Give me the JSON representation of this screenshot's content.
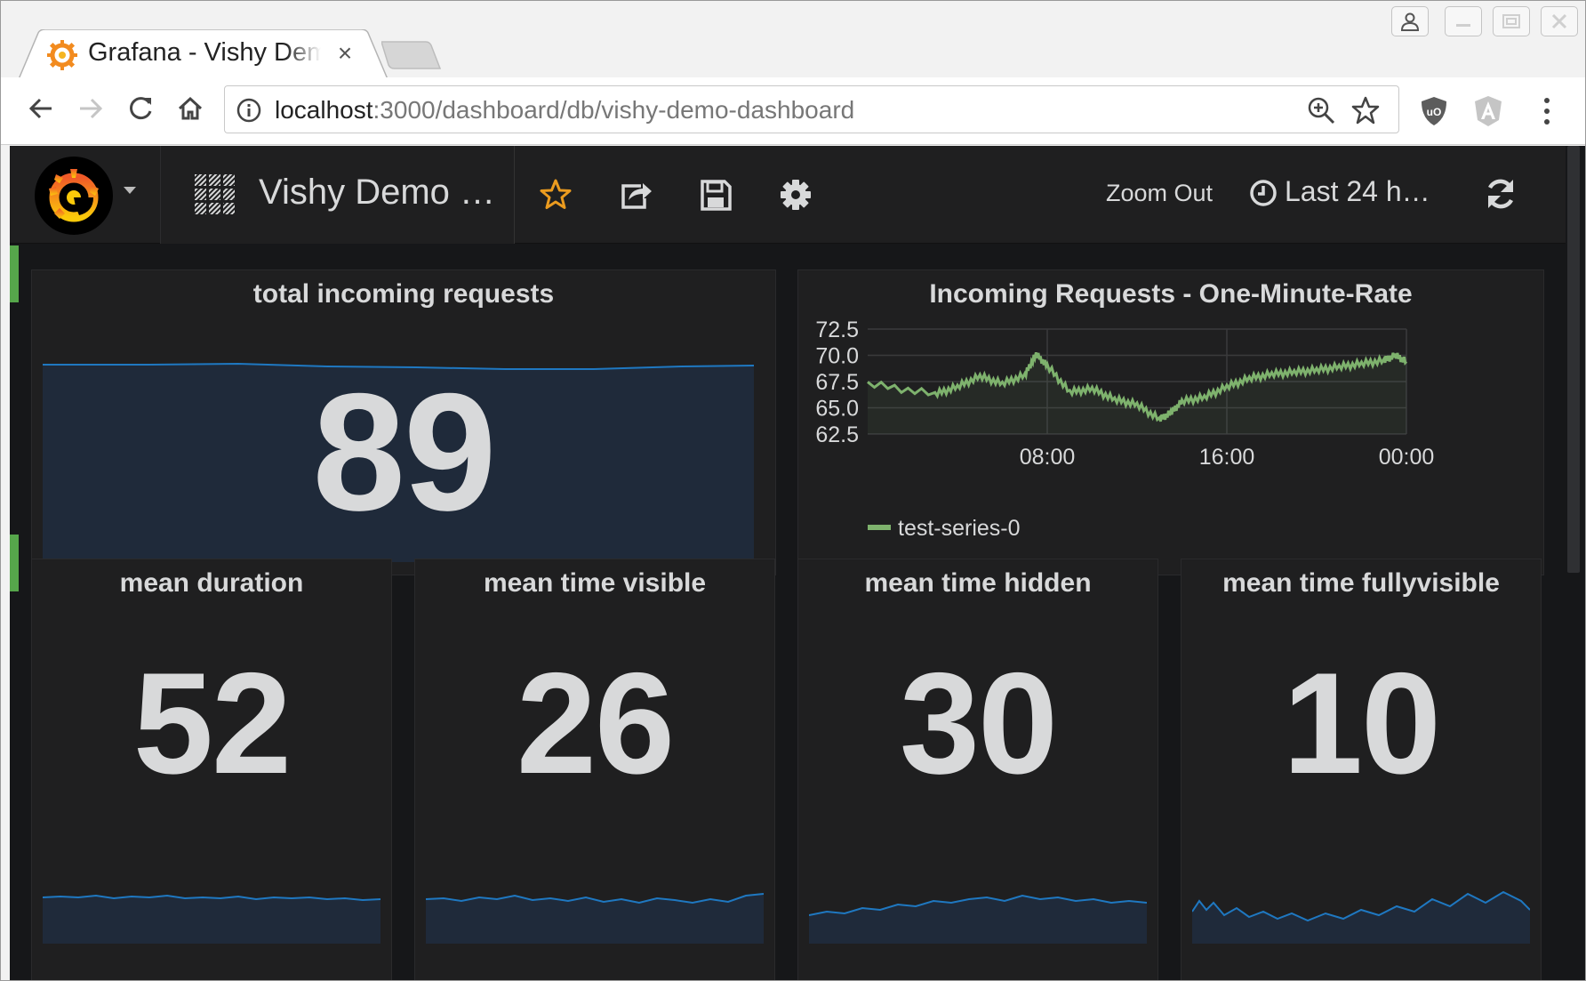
{
  "browser": {
    "tab_title": "Grafana - Vishy Demo Dashboard",
    "url_host": "localhost",
    "url_rest": ":3000/dashboard/db/vishy-demo-dashboard"
  },
  "navbar": {
    "dashboard_title": "Vishy Demo …",
    "zoom_out_label": "Zoom Out",
    "time_range_label": "Last 24 h…"
  },
  "panels": {
    "total_requests": {
      "title": "total incoming requests",
      "value": "89",
      "spark_color": "#1f78c1",
      "fill_color": "#1f2a3a"
    },
    "one_minute_rate": {
      "title": "Incoming Requests - One-Minute-Rate",
      "legend": "test-series-0"
    },
    "mean_duration": {
      "title": "mean duration",
      "value": "52"
    },
    "mean_time_visible": {
      "title": "mean time visible",
      "value": "26"
    },
    "mean_time_hidden": {
      "title": "mean time hidden",
      "value": "30"
    },
    "mean_time_fullyvisible": {
      "title": "mean time fullyvisible",
      "value": "10"
    }
  },
  "chart_data": {
    "type": "line",
    "title": "Incoming Requests - One-Minute-Rate",
    "xlabel": "",
    "ylabel": "",
    "x_ticks": [
      "08:00",
      "16:00",
      "00:00"
    ],
    "y_ticks": [
      62.5,
      65.0,
      67.5,
      70.0,
      72.5
    ],
    "ylim": [
      62.5,
      72.5
    ],
    "grid": true,
    "legend": "bottom-left",
    "colors": {
      "series": "#7eb26d"
    },
    "series": [
      {
        "name": "test-series-0",
        "x": [
          "02:00",
          "03:00",
          "04:00",
          "05:00",
          "06:00",
          "07:00",
          "07:30",
          "08:00",
          "09:00",
          "10:00",
          "11:00",
          "12:00",
          "13:00",
          "13:30",
          "14:00",
          "15:00",
          "16:00",
          "17:00",
          "18:00",
          "19:00",
          "20:00",
          "21:00",
          "22:00",
          "23:00",
          "23:30",
          "00:00"
        ],
        "values": [
          67.3,
          66.3,
          67.0,
          68.0,
          67.3,
          68.1,
          70.1,
          69.0,
          66.5,
          66.8,
          65.8,
          65.3,
          63.9,
          64.5,
          65.6,
          66.0,
          67.0,
          67.8,
          68.2,
          68.4,
          68.6,
          68.9,
          69.2,
          69.5,
          70.0,
          69.4
        ]
      }
    ]
  }
}
